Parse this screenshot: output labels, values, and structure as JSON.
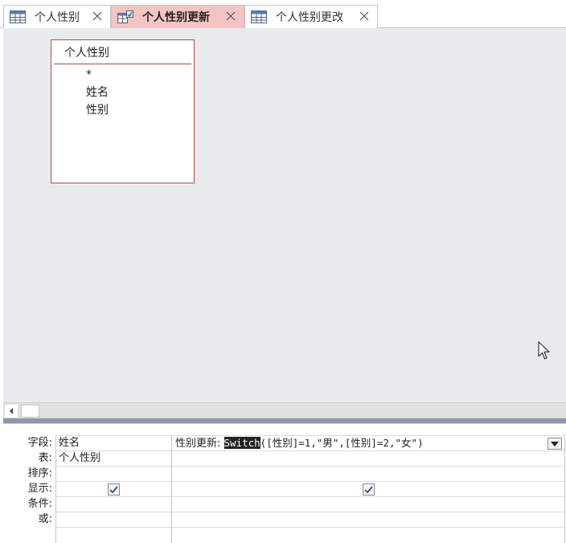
{
  "tabs": [
    {
      "label": "个人性别",
      "icon": "table-icon",
      "active": false
    },
    {
      "label": "个人性别更新",
      "icon": "update-query-icon",
      "active": true
    },
    {
      "label": "个人性别更改",
      "icon": "table-icon",
      "active": false
    }
  ],
  "field_list": {
    "title": "个人性别",
    "fields": [
      "*",
      "姓名",
      "性别"
    ]
  },
  "grid": {
    "row_labels": [
      "字段:",
      "表:",
      "排序:",
      "显示:",
      "条件:",
      "或:"
    ],
    "columns": [
      {
        "field": "姓名",
        "table": "个人性别",
        "show": true
      },
      {
        "field_prefix": "性别更新: ",
        "field_highlight": "Switch",
        "field_suffix": "([性别]=1,\"男\",[性别]=2,\"女\")",
        "table": "",
        "show": true
      }
    ]
  },
  "colors": {
    "active_tab": "#f6c3c3",
    "table_border": "#b04848",
    "canvas": "#e8ebee"
  }
}
